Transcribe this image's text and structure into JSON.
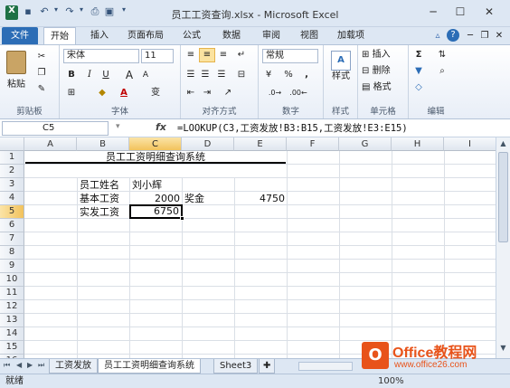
{
  "window": {
    "title": "员工工资查询.xlsx - Microsoft Excel",
    "minimize": "─",
    "maximize": "☐",
    "close": "✕"
  },
  "qat": {
    "undo": "↶",
    "redo": "↷",
    "dropdown": "▾"
  },
  "tabs": [
    "文件",
    "开始",
    "插入",
    "页面布局",
    "公式",
    "数据",
    "审阅",
    "视图",
    "加载项"
  ],
  "ribbon": {
    "clipboard": {
      "label": "剪贴板",
      "paste": "粘贴"
    },
    "font": {
      "label": "字体",
      "name": "宋体",
      "size": "11",
      "bold": "B",
      "italic": "I",
      "underline": "U",
      "grow": "A",
      "shrink": "A",
      "color_glyph": "A",
      "phonetic": "变"
    },
    "alignment": {
      "label": "对齐方式"
    },
    "number": {
      "label": "数字",
      "format": "常规",
      "percent": "%",
      "comma": ","
    },
    "styles": {
      "label": "样式",
      "button": "样式"
    },
    "cells": {
      "label": "单元格",
      "insert": "插入",
      "delete": "删除",
      "format": "格式"
    },
    "editing": {
      "label": "编辑",
      "sum": "Σ"
    }
  },
  "formula_bar": {
    "name_box": "C5",
    "fx": "fx",
    "formula": "=LOOKUP(C3,工资发放!B3:B15,工资发放!E3:E15)"
  },
  "columns": [
    "A",
    "B",
    "C",
    "D",
    "E",
    "F",
    "G",
    "H",
    "I"
  ],
  "rows": [
    "1",
    "2",
    "3",
    "4",
    "5",
    "6",
    "7",
    "8",
    "9",
    "10",
    "11",
    "12",
    "13",
    "14",
    "15",
    "16"
  ],
  "cells": {
    "title": "员工工资明细查询系统",
    "name_label": "员工姓名",
    "name_value": "刘小辉",
    "basic_label": "基本工资",
    "basic_value": "2000",
    "bonus_label": "奖金",
    "bonus_value": "4750",
    "actual_label": "实发工资",
    "actual_value": "6750"
  },
  "sheets": [
    "工资发放",
    "员工工资明细查询系统",
    "Sheet3"
  ],
  "status": {
    "ready": "就绪",
    "zoom": "100%"
  },
  "watermark": {
    "brand": "Office教程网",
    "url": "www.office26.com"
  },
  "colors": {
    "accent": "#2c6db6",
    "selection": "#f2c25c",
    "ribbon_bg": "#dde7f3",
    "watermark": "#e8531a"
  }
}
